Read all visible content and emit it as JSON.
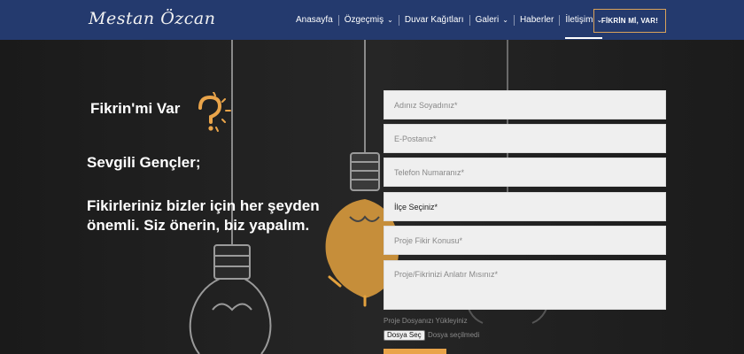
{
  "header": {
    "logo": "Mestan Özcan",
    "nav": [
      {
        "label": "Anasayfa",
        "dropdown": false,
        "active": false
      },
      {
        "label": "Özgeçmiş",
        "dropdown": true,
        "active": false
      },
      {
        "label": "Duvar Kağıtları",
        "dropdown": false,
        "active": false
      },
      {
        "label": "Galeri",
        "dropdown": true,
        "active": false
      },
      {
        "label": "Haberler",
        "dropdown": false,
        "active": false
      },
      {
        "label": "İletişim",
        "dropdown": true,
        "active": true
      }
    ],
    "cta_label": "FİKRİN Mİ, VAR!"
  },
  "hero": {
    "brand_title": "Fikrin'mi Var",
    "greeting": "Sevgili Gençler;",
    "message": "Fikirleriniz bizler için her şeyden önemli. Siz önerin, biz yapalım."
  },
  "form": {
    "name_placeholder": "Adınız Soyadınız*",
    "email_placeholder": "E-Postanız*",
    "phone_placeholder": "Telefon Numaranız*",
    "district_select": "İlçe Seçiniz*",
    "topic_placeholder": "Proje Fikir Konusu*",
    "description_placeholder": "Proje/Fikrinizi Anlatır Mısınız*",
    "upload_label": "Proje Dosyanızı Yükleyiniz",
    "file_button": "Dosya Seç",
    "file_status": "Dosya seçilmedi"
  },
  "colors": {
    "header_bg": "#243a6e",
    "accent": "#e9a44a",
    "hero_bg": "#1c1c1c"
  },
  "icons": [
    "question-mark-icon",
    "chevron-down-icon"
  ]
}
